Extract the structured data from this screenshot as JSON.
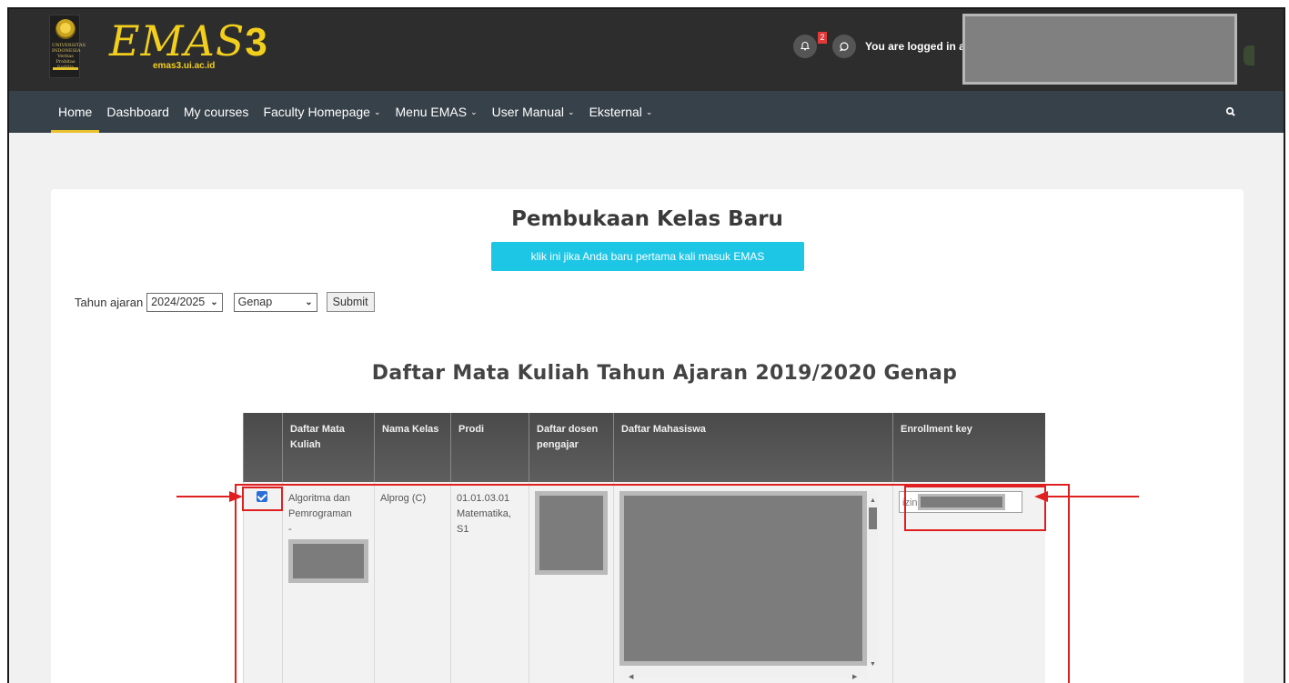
{
  "header": {
    "crest_text": "UNIVERSITAS INDONESIA Veritas Probitas Iustitia",
    "logo": {
      "script": "EMAS",
      "number": "3",
      "subtitle": "emas3.ui.ac.id"
    },
    "notifications_count": "2",
    "logged_in_text": "You are logged in as"
  },
  "nav": {
    "items": [
      {
        "label": "Home",
        "active": true
      },
      {
        "label": "Dashboard"
      },
      {
        "label": "My courses"
      },
      {
        "label": "Faculty Homepage",
        "caret": "⌄"
      },
      {
        "label": "Menu EMAS",
        "caret": "⌄"
      },
      {
        "label": "User Manual",
        "caret": "⌄"
      },
      {
        "label": "Eksternal",
        "caret": "⌄"
      }
    ]
  },
  "page": {
    "title": "Pembukaan Kelas Baru",
    "first_time_button": "klik ini jika Anda baru pertama kali masuk EMAS",
    "filter": {
      "label": "Tahun ajaran",
      "year_value": "2024/2025",
      "semester_value": "Genap",
      "submit_label": "Submit"
    },
    "list_title": "Daftar Mata Kuliah Tahun Ajaran 2019/2020 Genap"
  },
  "table": {
    "headers": [
      "",
      "Daftar Mata Kuliah",
      "Nama Kelas",
      "Prodi",
      "Daftar dosen pengajar",
      "Daftar Mahasiswa",
      "Enrollment key"
    ],
    "row": {
      "checked": true,
      "course": "Algoritma dan Pemrograman",
      "course_suffix": "-",
      "class_name": "Alprog (C)",
      "prodi": "01.01.03.01 Matematika, S1",
      "enrollment_key_prefix": "izin"
    }
  },
  "colors": {
    "topbar": "#2d2d2d",
    "navbar": "#374149",
    "accent_yellow": "#f2cf1d",
    "cta": "#1ec6e6",
    "annotation_red": "#e02020"
  }
}
